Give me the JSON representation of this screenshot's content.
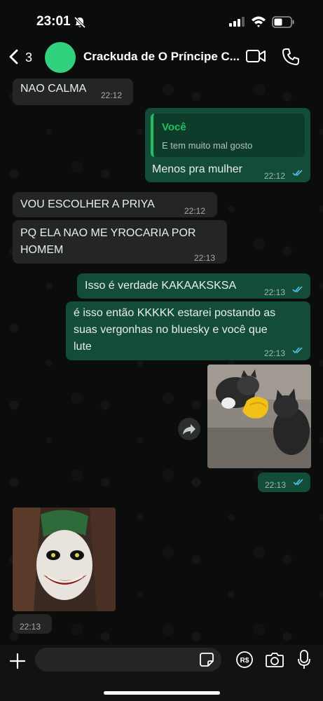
{
  "status_bar": {
    "time": "23:01",
    "icons": [
      "bell-slash-icon",
      "cellular-signal-icon",
      "wifi-icon",
      "battery-icon"
    ]
  },
  "header": {
    "back_count": "3",
    "title": "Crackuda de O Príncipe C...",
    "avatar_color": "#31d17e",
    "icons": [
      "chevron-left-icon",
      "video-camera-icon",
      "phone-icon"
    ]
  },
  "messages": [
    {
      "direction": "in",
      "text": "NAO CALMA",
      "time": "22:12"
    },
    {
      "direction": "out",
      "quote_author": "Você",
      "quote_text": "E tem muito mal gosto",
      "text": "Menos pra mulher",
      "time": "22:12",
      "read": true
    },
    {
      "direction": "in",
      "text": "VOU ESCOLHER A PRIYA",
      "time": "22:12"
    },
    {
      "direction": "in",
      "text_lines": [
        "PQ ELA NAO ME YROCARIA POR",
        "HOMEM"
      ],
      "time": "22:13"
    },
    {
      "direction": "out",
      "text": "Isso é verdade KAKAAKSKSA",
      "time": "22:13",
      "read": true
    },
    {
      "direction": "out",
      "text_lines": [
        "é isso então KKKKK estarei postando as",
        "suas vergonhas no bluesky e você que",
        "lute"
      ],
      "time": "22:13",
      "read": true
    },
    {
      "direction": "out",
      "type": "image",
      "image": "two-kittens-shaking-hands",
      "time": "22:13",
      "read": true
    },
    {
      "direction": "in",
      "type": "image",
      "image": "joker-face",
      "time": "22:13"
    }
  ],
  "input_bar": {
    "placeholder": "",
    "icons": [
      "plus-icon",
      "sticker-icon",
      "payment-icon",
      "camera-icon",
      "microphone-icon"
    ]
  },
  "colors": {
    "incoming_bubble": "#242626",
    "outgoing_bubble": "#134d37",
    "accent": "#21c063",
    "read_ticks": "#53bdeb"
  }
}
